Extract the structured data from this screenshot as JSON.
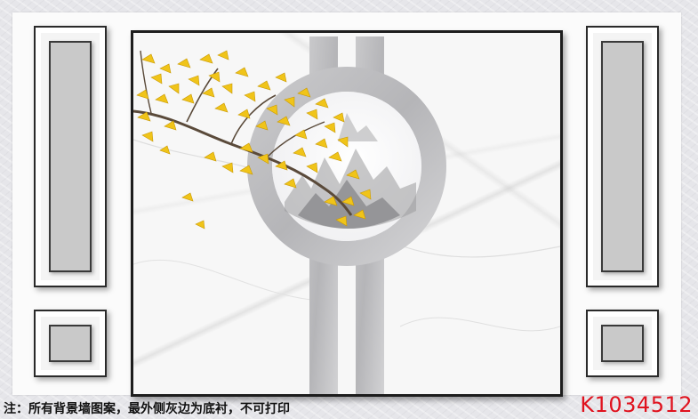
{
  "footer": {
    "note": "注：所有背景墙图案，最外侧灰边为底衬，不可打印",
    "product_code": "K1034512"
  },
  "colors": {
    "panel_gray": "#c9c9c9",
    "frame_black": "#1d1d1d",
    "ginkgo_yellow": "#f0c419",
    "code_red": "#e0121e"
  }
}
